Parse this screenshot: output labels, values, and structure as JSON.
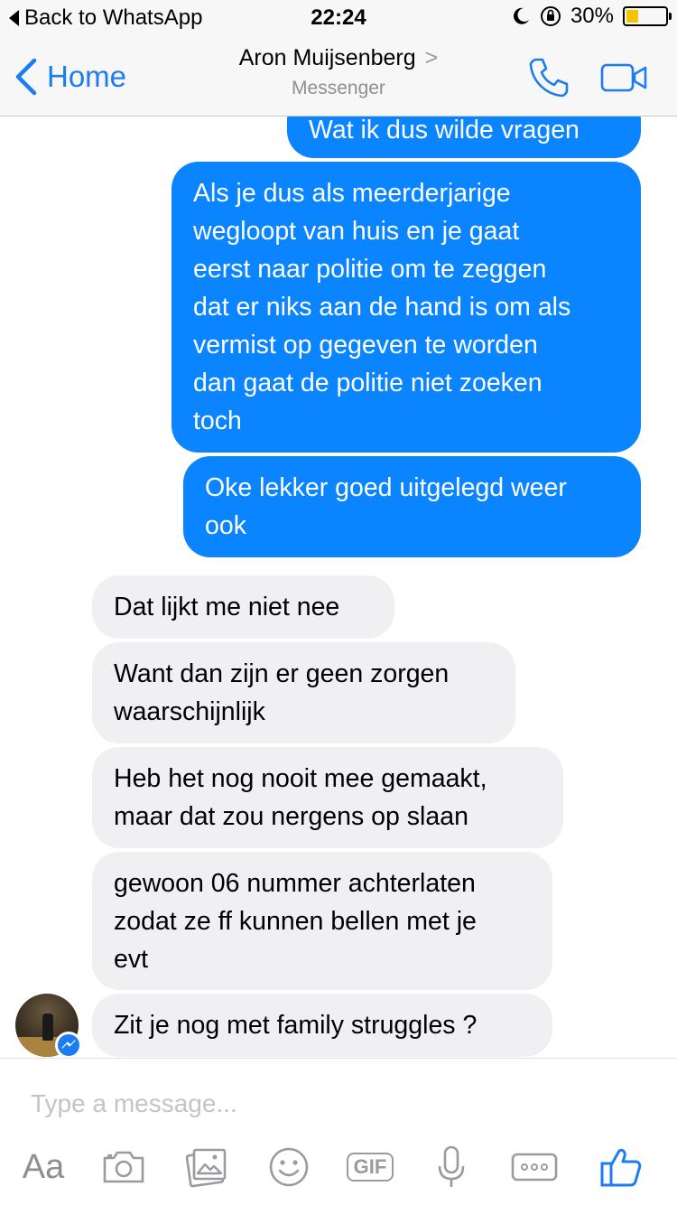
{
  "status_bar": {
    "back_label": "Back to WhatsApp",
    "time": "22:24",
    "battery": "30%",
    "battery_level": 0.3,
    "icons": [
      "moon-icon",
      "orientation-lock-icon",
      "battery-icon"
    ]
  },
  "nav": {
    "back_label": "Home",
    "contact_name": "Aron Muijsenberg",
    "chevron": ">",
    "subtitle": "Messenger",
    "accent": "#1c7cf4"
  },
  "messages": [
    {
      "side": "out",
      "text": "Wat ik dus wilde vragen"
    },
    {
      "side": "out",
      "text": "Als je dus als meerderjarige\nwegloopt van huis en je gaat\neerst naar politie om te zeggen\ndat er niks aan de hand is om als\nvermist op gegeven te worden\ndan gaat de politie niet zoeken\ntoch"
    },
    {
      "side": "out",
      "text": "Oke lekker goed uitgelegd weer\nook"
    },
    {
      "side": "in",
      "text": "Dat lijkt me niet nee"
    },
    {
      "side": "in",
      "text": "Want dan zijn er geen zorgen\nwaarschijnlijk"
    },
    {
      "side": "in",
      "text": "Heb het nog nooit mee gemaakt,\nmaar dat zou nergens op slaan"
    },
    {
      "side": "in",
      "text": "gewoon 06 nummer achterlaten\nzodat ze ff kunnen bellen met je\nevt"
    },
    {
      "side": "in",
      "text": "Zit je nog met family struggles ?"
    }
  ],
  "colors": {
    "outgoing_bubble": "#0a84ff",
    "incoming_bubble": "#f0f0f3",
    "battery_fill": "#f5c400"
  },
  "composer": {
    "placeholder": "Type a message...",
    "aa_label": "Aa",
    "gif_label": "GIF",
    "tools": [
      "aa-text",
      "camera-icon",
      "gallery-icon",
      "emoji-icon",
      "gif-button",
      "microphone-icon",
      "more-icon",
      "thumbs-up-icon"
    ]
  }
}
